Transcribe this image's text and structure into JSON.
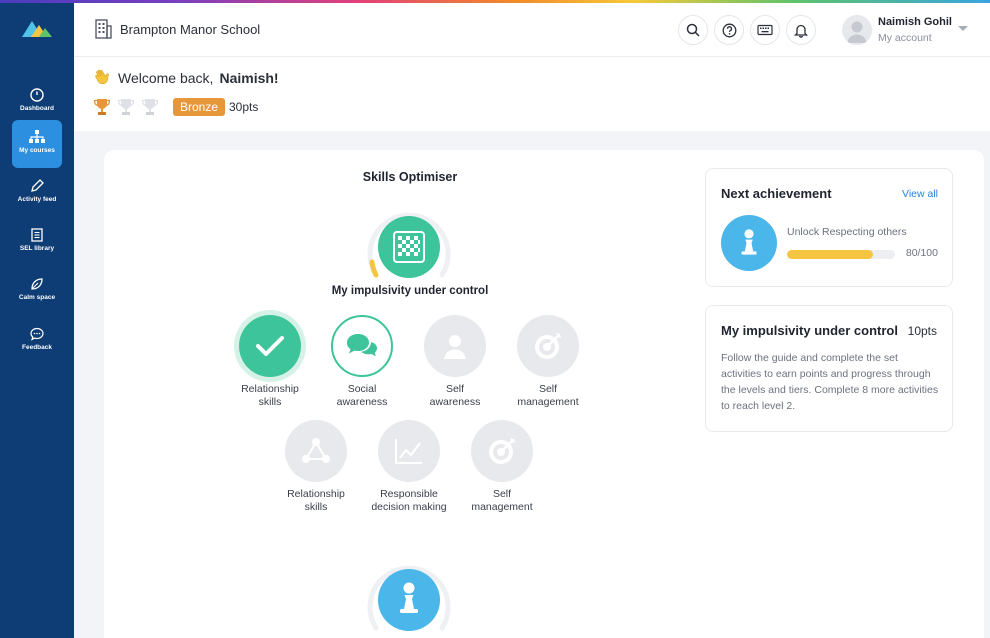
{
  "header": {
    "school_name": "Brampton Manor School",
    "user_name": "Naimish Gohil",
    "user_sub": "My account"
  },
  "sidebar": {
    "items": [
      {
        "label": "Dashboard",
        "icon": "dashboard-icon"
      },
      {
        "label": "My courses",
        "icon": "courses-icon",
        "active": true
      },
      {
        "label": "Activity feed",
        "icon": "pencil-icon"
      },
      {
        "label": "SEL library",
        "icon": "library-icon"
      },
      {
        "label": "Calm space",
        "icon": "leaf-icon"
      },
      {
        "label": "Feedback",
        "icon": "chat-icon"
      }
    ]
  },
  "welcome": {
    "prefix": "Welcome back,",
    "name": "Naimish!",
    "badge": "Bronze",
    "points": "30pts",
    "trophies_earned": 1,
    "trophies_total": 3
  },
  "optimiser": {
    "title": "Skills Optimiser",
    "current_skill": "My impulsivity under control",
    "skills_row1": [
      {
        "name": "Relationship skills",
        "line1": "Relationship",
        "line2": "skills",
        "state": "done"
      },
      {
        "name": "Social awareness",
        "line1": "Social",
        "line2": "awareness",
        "state": "active"
      },
      {
        "name": "Self awareness",
        "line1": "Self",
        "line2": "awareness",
        "state": "locked"
      },
      {
        "name": "Self management",
        "line1": "Self",
        "line2": "management",
        "state": "locked"
      }
    ],
    "skills_row2": [
      {
        "name": "Relationship skills",
        "line1": "Relationship",
        "line2": "skills",
        "state": "locked"
      },
      {
        "name": "Responsible decision making",
        "line1": "Responsible",
        "line2": "decision making",
        "state": "locked"
      },
      {
        "name": "Self management",
        "line1": "Self",
        "line2": "management",
        "state": "locked"
      }
    ]
  },
  "next_achievement": {
    "title": "Next achievement",
    "view_all": "View all",
    "unlock_text": "Unlock Respecting others",
    "progress": 80,
    "progress_max": 100,
    "progress_label": "80/100"
  },
  "skill_card": {
    "title": "My impulsivity under control",
    "points": "10pts",
    "description": "Follow the guide and complete the set activities to earn points and progress through the levels and tiers. Complete 8 more activities to reach level 2."
  },
  "colors": {
    "sidebar": "#0e3c74",
    "active": "#2d8fe0",
    "green": "#3ec49a",
    "badge": "#e6973a",
    "progress": "#f5c542",
    "blue": "#4ab6ea"
  }
}
